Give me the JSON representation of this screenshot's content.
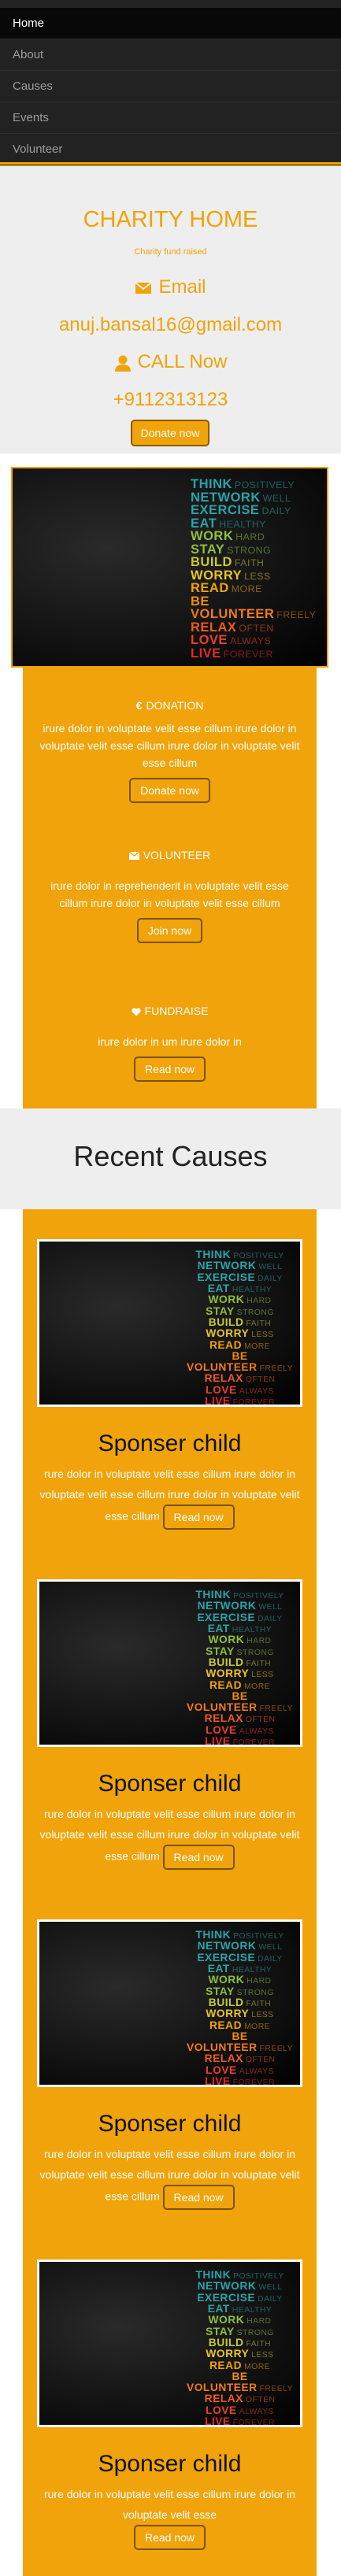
{
  "nav": {
    "items": [
      {
        "label": "Home",
        "active": true
      },
      {
        "label": "About",
        "active": false
      },
      {
        "label": "Causes",
        "active": false
      },
      {
        "label": "Events",
        "active": false
      },
      {
        "label": "Volunteer",
        "active": false
      }
    ]
  },
  "hero": {
    "title": "CHARITY HOME",
    "subtitle": "Charity fund raised",
    "email_label": "Email",
    "email": "anuj.bansal16@gmail.com",
    "call_label": "CALL Now",
    "phone": "+9112313123",
    "donate_button": "Donate now"
  },
  "banner": {
    "words": [
      {
        "big": "THINK",
        "small": "POSITIVELY",
        "color": "#2aa3a8"
      },
      {
        "big": "NETWORK",
        "small": "WELL",
        "color": "#2aa3a8"
      },
      {
        "big": "EXERCISE",
        "small": "DAILY",
        "color": "#2aa3a8"
      },
      {
        "big": "EAT",
        "small": "HEALTHY",
        "color": "#2aa3a8"
      },
      {
        "big": "WORK",
        "small": "HARD",
        "color": "#8fbf3a"
      },
      {
        "big": "STAY",
        "small": "STRONG",
        "color": "#8fbf3a"
      },
      {
        "big": "BUILD",
        "small": "FAITH",
        "color": "#c7c83a"
      },
      {
        "big": "WORRY",
        "small": "LESS",
        "color": "#e8c22a"
      },
      {
        "big": "READ",
        "small": "MORE",
        "color": "#f0a30a"
      },
      {
        "big": "BE",
        "small": "",
        "color": "#f08a12"
      },
      {
        "big": "VOLUNTEER",
        "small": "FREELY",
        "color": "#f07a1a"
      },
      {
        "big": "RELAX",
        "small": "OFTEN",
        "color": "#ee5a22"
      },
      {
        "big": "LOVE",
        "small": "ALWAYS",
        "color": "#e8402a"
      },
      {
        "big": "LIVE",
        "small": "FOREVER",
        "color": "#e02a2a"
      }
    ]
  },
  "features": [
    {
      "icon": "euro-icon",
      "title": "DONATION",
      "text": "irure dolor in voluptate velit esse cillum irure dolor in voluptate velit esse cillum irure dolor in voluptate velit esse cillum",
      "button": "Donate now"
    },
    {
      "icon": "envelope-icon",
      "title": "VOLUNTEER",
      "text": "irure dolor in reprehenderit in voluptate velit esse cillum irure dolor in voluptate velit esse cillum",
      "button": "Join now"
    },
    {
      "icon": "heart-icon",
      "title": "FUNDRAISE",
      "text": "irure dolor in um irure dolor in",
      "button": "Read now"
    }
  ],
  "recent": {
    "title": "Recent Causes",
    "causes": [
      {
        "title": "Sponser child",
        "text": "rure dolor in voluptate velit esse cillum irure dolor in voluptate velit esse cillum irure dolor in voluptate velit esse cillum",
        "button": "Read now"
      },
      {
        "title": "Sponser child",
        "text": "rure dolor in voluptate velit esse cillum irure dolor in voluptate velit esse cillum irure dolor in voluptate velit esse cillum",
        "button": "Read now"
      },
      {
        "title": "Sponser child",
        "text": "rure dolor in voluptate velit esse cillum irure dolor in voluptate velit esse cillum irure dolor in voluptate velit esse cillum",
        "button": "Read now"
      },
      {
        "title": "Sponser child",
        "text": "rure dolor in voluptate velit esse cillum irure dolor in voluptate velit esse",
        "button": "Read now"
      }
    ]
  },
  "colors": {
    "accent": "#f0a30a",
    "nav_bg": "#222222",
    "hero_bg": "#eeeeee"
  }
}
